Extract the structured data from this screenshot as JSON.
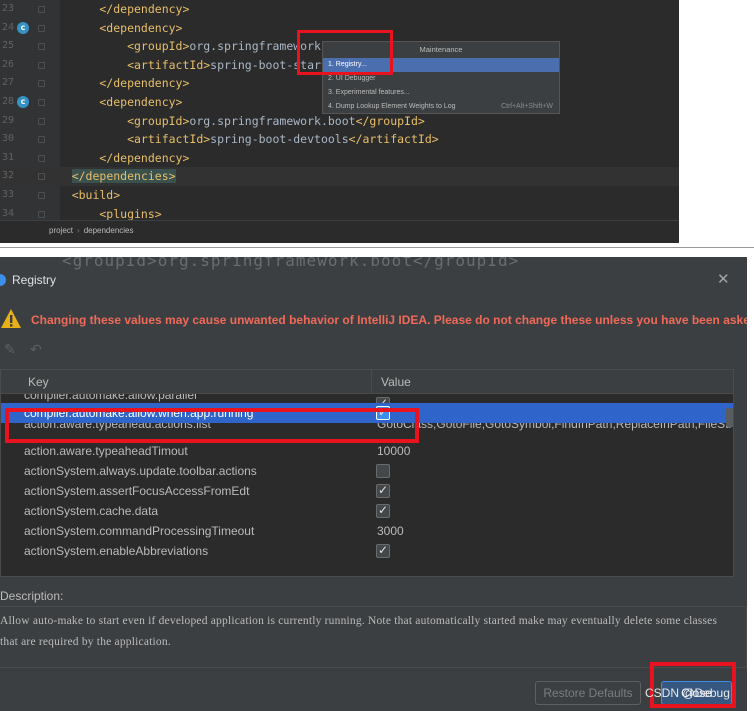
{
  "editor": {
    "lines": [
      {
        "num": "23",
        "segments": [
          {
            "cls": "tag",
            "t": "        </dependency>"
          }
        ]
      },
      {
        "num": "24",
        "segments": [
          {
            "cls": "tag",
            "t": "        <dependency>"
          }
        ]
      },
      {
        "num": "25",
        "segments": [
          {
            "cls": "tag",
            "t": "            <groupId>"
          },
          {
            "cls": "txt",
            "t": "org.springframework.b"
          }
        ]
      },
      {
        "num": "26",
        "segments": [
          {
            "cls": "tag",
            "t": "            <artifactId>"
          },
          {
            "cls": "txt",
            "t": "spring-boot-starte"
          }
        ]
      },
      {
        "num": "27",
        "segments": [
          {
            "cls": "tag",
            "t": "        </dependency>"
          }
        ]
      },
      {
        "num": "28",
        "segments": [
          {
            "cls": "tag",
            "t": "        <dependency>"
          }
        ]
      },
      {
        "num": "29",
        "segments": [
          {
            "cls": "tag",
            "t": "            <groupId>"
          },
          {
            "cls": "txt",
            "t": "org.springframework.boot"
          },
          {
            "cls": "tag",
            "t": "</groupId>"
          }
        ]
      },
      {
        "num": "30",
        "segments": [
          {
            "cls": "tag",
            "t": "            <artifactId>"
          },
          {
            "cls": "txt",
            "t": "spring-boot-devtools"
          },
          {
            "cls": "tag",
            "t": "</artifactId>"
          }
        ]
      },
      {
        "num": "31",
        "segments": [
          {
            "cls": "tag",
            "t": "        </dependency>"
          }
        ]
      },
      {
        "num": "32",
        "segments": [
          {
            "cls": "txt",
            "t": "    "
          },
          {
            "cls": "tag-hl",
            "t": "</dependencies>"
          }
        ]
      },
      {
        "num": "33",
        "segments": [
          {
            "cls": "tag",
            "t": "    <build>"
          }
        ]
      },
      {
        "num": "34",
        "segments": [
          {
            "cls": "tag",
            "t": "        <plugins>"
          }
        ]
      }
    ],
    "breadcrumbs": [
      "project",
      "dependencies"
    ]
  },
  "popup": {
    "title": "Maintenance",
    "items": [
      {
        "label": "1. Registry...",
        "shortcut": ""
      },
      {
        "label": "2. UI Debugger",
        "shortcut": ""
      },
      {
        "label": "3. Experimental features...",
        "shortcut": ""
      },
      {
        "label": "4. Dump Lookup Element Weights to Log",
        "shortcut": "Ctrl+Alt+Shift+W"
      }
    ]
  },
  "dialog": {
    "ghost_text": "<groupId>org.springframework.boot</groupId>",
    "title": "Registry",
    "close_glyph": "✕",
    "warning": "Changing these values may cause unwanted behavior of IntelliJ IDEA. Please do not change these unless you have been asked.",
    "table": {
      "headers": [
        "Key",
        "Value"
      ],
      "rows": [
        {
          "key": "compiler.automake.allow.parallel",
          "value": "",
          "checkbox": true,
          "checked": true,
          "state": "partial"
        },
        {
          "key": "compiler.automake.allow.when.app.running",
          "value": "",
          "checkbox": true,
          "checked": true,
          "state": "selected"
        },
        {
          "key": "action.aware.typeahead.actions.list",
          "value": "GotoClass,GotoFile,GotoSymbol,FindInPath,ReplaceInPath,FileStructure",
          "checkbox": false,
          "checked": false,
          "state": "clipped"
        },
        {
          "key": "action.aware.typeaheadTimout",
          "value": "10000",
          "checkbox": false,
          "checked": false,
          "state": ""
        },
        {
          "key": "actionSystem.always.update.toolbar.actions",
          "value": "",
          "checkbox": true,
          "checked": false,
          "state": ""
        },
        {
          "key": "actionSystem.assertFocusAccessFromEdt",
          "value": "",
          "checkbox": true,
          "checked": true,
          "state": ""
        },
        {
          "key": "actionSystem.cache.data",
          "value": "",
          "checkbox": true,
          "checked": true,
          "state": ""
        },
        {
          "key": "actionSystem.commandProcessingTimeout",
          "value": "3000",
          "checkbox": false,
          "checked": false,
          "state": ""
        },
        {
          "key": "actionSystem.enableAbbreviations",
          "value": "",
          "checkbox": true,
          "checked": true,
          "state": ""
        }
      ]
    },
    "description_label": "Description:",
    "description": "Allow auto-make to start even if developed application is currently running. Note that automatically started make may eventually delete some classes that are required by the application.",
    "restore_defaults_label": "Restore Defaults",
    "close_label": "Close"
  },
  "watermark": "CSDN @Debug",
  "colors": {
    "highlight_box": "#e8131e",
    "selection": "#2f65ca",
    "warning_text": "#f06a5a"
  }
}
